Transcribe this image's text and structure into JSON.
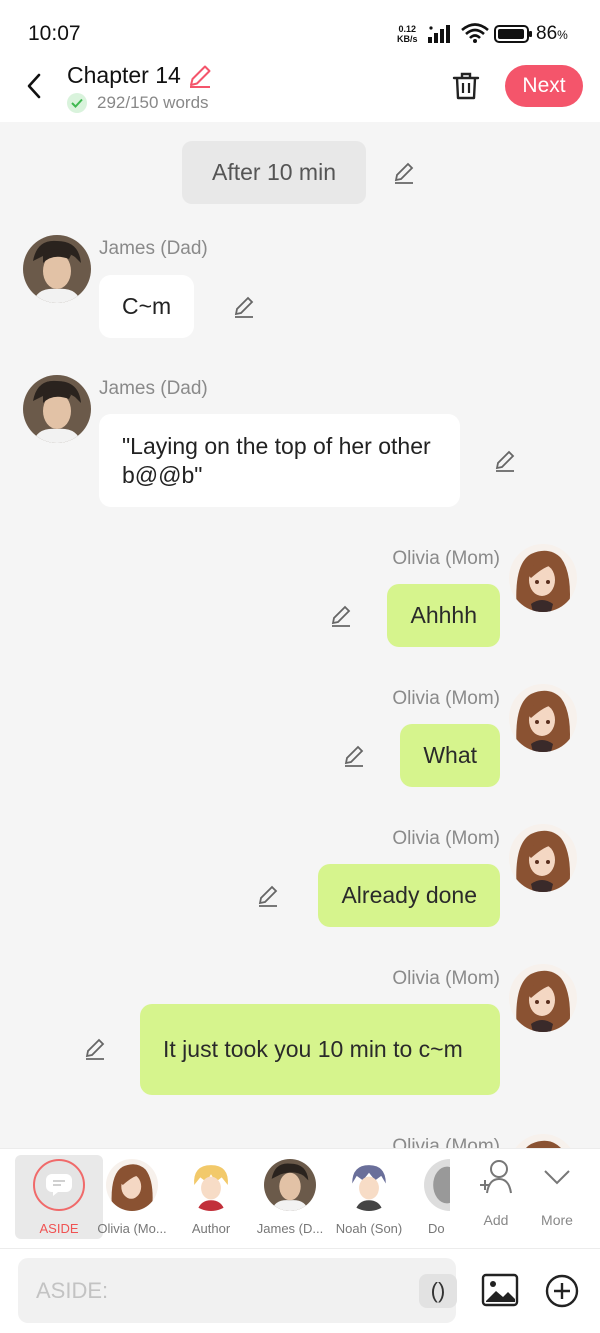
{
  "status_bar": {
    "time": "10:07",
    "speed_value": "0.12",
    "speed_unit": "KB/s",
    "battery": "86",
    "battery_unit": "%"
  },
  "header": {
    "title": "Chapter 14",
    "word_count": "292/150 words",
    "next_label": "Next",
    "icons": [
      "back-arrow-icon",
      "pencil-icon",
      "check-icon",
      "trash-icon"
    ]
  },
  "chat": {
    "aside_text": "After 10 min",
    "messages": [
      {
        "name": "James (Dad)",
        "text": "C~m",
        "side": "left",
        "avatar": "dark-haired-man"
      },
      {
        "name": "James (Dad)",
        "text": "\"Laying on the top of her other b@@b\"",
        "side": "left",
        "avatar": "dark-haired-man"
      },
      {
        "name": "Olivia (Mom)",
        "text": "Ahhhh",
        "side": "right",
        "avatar": "brown-haired-woman"
      },
      {
        "name": "Olivia (Mom)",
        "text": "What",
        "side": "right",
        "avatar": "brown-haired-woman"
      },
      {
        "name": "Olivia (Mom)",
        "text": "Already done",
        "side": "right",
        "avatar": "brown-haired-woman"
      },
      {
        "name": "Olivia (Mom)",
        "text": "It just took you 10 min to c~m",
        "side": "right",
        "avatar": "brown-haired-woman"
      },
      {
        "name": "Olivia (Mom)",
        "text": "",
        "side": "right",
        "avatar": "brown-haired-woman"
      }
    ]
  },
  "characters": {
    "items": [
      {
        "label": "ASIDE",
        "selected": true
      },
      {
        "label": "Olivia (Mo...",
        "selected": false
      },
      {
        "label": "Author",
        "selected": false
      },
      {
        "label": "James (D...",
        "selected": false
      },
      {
        "label": "Noah (Son)",
        "selected": false
      },
      {
        "label": "Do",
        "selected": false
      }
    ],
    "add_label": "Add",
    "more_label": "More"
  },
  "input": {
    "placeholder": "ASIDE:",
    "paren_label": "()"
  },
  "colors": {
    "accent": "#f4556b",
    "bubble_right": "#d6f48d",
    "bubble_left": "#ffffff",
    "background": "#f5f5f5"
  }
}
